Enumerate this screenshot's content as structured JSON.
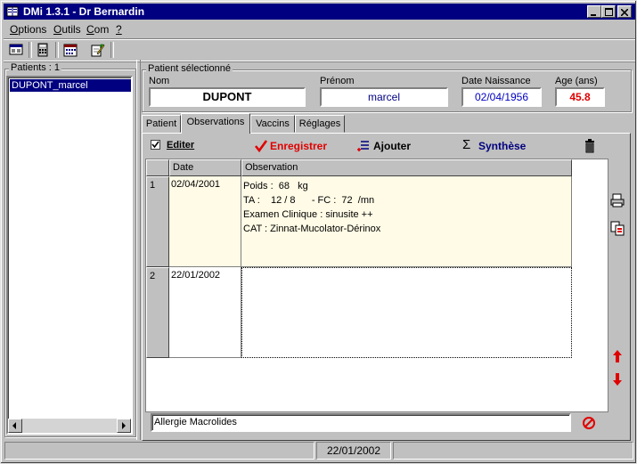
{
  "window": {
    "title": "DMi 1.3.1 - Dr Bernardin"
  },
  "menu": [
    {
      "label": "Options",
      "u": "O",
      "rest": "ptions"
    },
    {
      "label": "Outils",
      "u": "O",
      "rest": "utils"
    },
    {
      "label": "Com",
      "u": "C",
      "rest": "om"
    },
    {
      "label": "?",
      "u": "?",
      "rest": ""
    }
  ],
  "patients": {
    "group_label": "Patients : 1",
    "items": [
      "DUPONT_marcel"
    ]
  },
  "selected": {
    "group_label": "Patient sélectionné",
    "nom_label": "Nom",
    "nom": "DUPONT",
    "prenom_label": "Prénom",
    "prenom": "marcel",
    "dob_label": "Date Naissance",
    "dob": "02/04/1956",
    "age_label": "Age (ans)",
    "age": "45.8"
  },
  "tabs": [
    "Patient",
    "Observations",
    "Vaccins",
    "Réglages"
  ],
  "actions": {
    "editer": "Editer",
    "enregistrer": "Enregistrer",
    "ajouter": "Ajouter",
    "synthese": "Synthèse"
  },
  "grid": {
    "headers": [
      "Date",
      "Observation"
    ],
    "rows": [
      {
        "num": "1",
        "date": "02/04/2001",
        "lines": [
          "Poids :  68   kg",
          "TA :    12 / 8      - FC :  72  /mn",
          "Examen Clinique : sinusite ++",
          "CAT : Zinnat-Mucolator-Dérinox"
        ]
      },
      {
        "num": "2",
        "date": "22/01/2002",
        "lines": []
      }
    ]
  },
  "allergy": "Allergie Macrolides",
  "status": {
    "date": "22/01/2002"
  },
  "colors": {
    "title_bg": "#000080",
    "accent_red": "#e00000",
    "accent_blue": "#000080",
    "row_yellow": "#fffbe6"
  }
}
